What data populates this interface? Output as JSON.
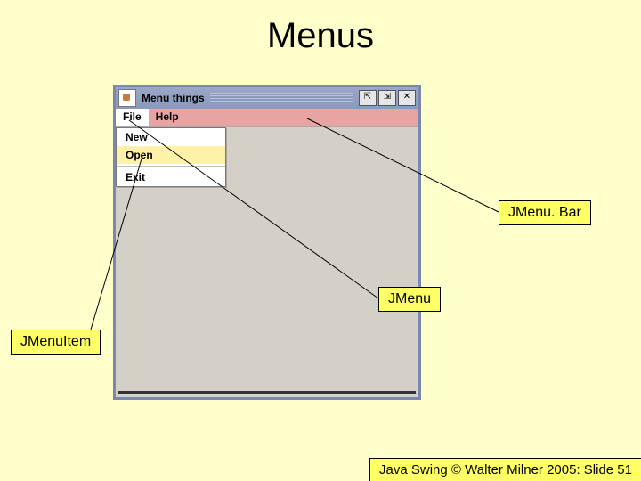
{
  "title": "Menus",
  "window": {
    "title": "Menu things",
    "buttons": {
      "min": "⇱",
      "max": "⇲",
      "close": "✕"
    }
  },
  "menubar": {
    "items": [
      {
        "label": "File",
        "active": true
      },
      {
        "label": "Help",
        "active": false
      }
    ]
  },
  "dropdown": {
    "items": [
      {
        "label": "New",
        "highlight": false
      },
      {
        "label": "Open",
        "highlight": true
      },
      {
        "label": "Exit",
        "highlight": false
      }
    ]
  },
  "annotations": {
    "menubar": "JMenu. Bar",
    "menu": "JMenu",
    "menuitem": "JMenuItem"
  },
  "footer": "Java Swing © Walter Milner 2005: Slide 51"
}
